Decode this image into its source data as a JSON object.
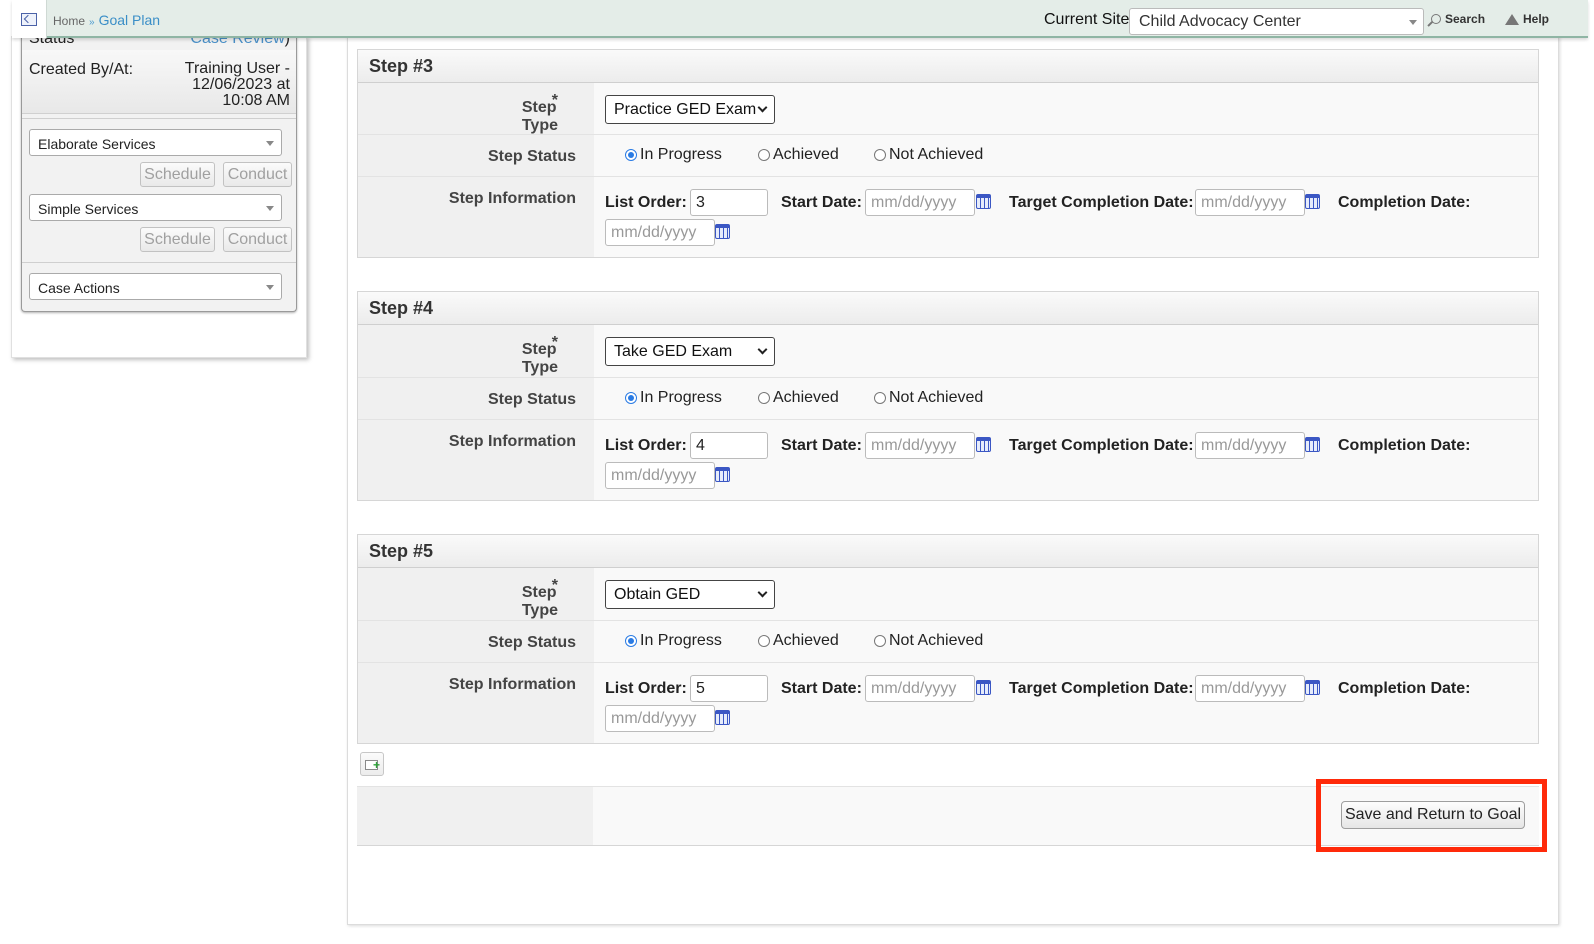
{
  "topbar": {
    "breadcrumb_home": "Home",
    "breadcrumb_sep": "»",
    "breadcrumb_current": "Goal Plan",
    "current_site_label": "Current Site",
    "current_site_value": "Child Advocacy Center",
    "search_label": "Search",
    "help_label": "Help"
  },
  "left_panel": {
    "status_label": "Status",
    "status_value": "Case Review",
    "created_label": "Created By/At:",
    "created_line1": "Training User -",
    "created_line2": "12/06/2023 at",
    "created_line3": "10:08 AM",
    "elaborate_services": "Elaborate Services",
    "simple_services": "Simple Services",
    "case_actions": "Case Actions",
    "schedule_label": "Schedule",
    "conduct_label": "Conduct"
  },
  "labels": {
    "step_type": "Step Type",
    "required_mark": "*",
    "step_status": "Step Status",
    "step_information": "Step Information",
    "in_progress": "In Progress",
    "achieved": "Achieved",
    "not_achieved": "Not Achieved",
    "list_order": "List Order:",
    "start_date": "Start Date:",
    "target_completion_date": "Target Completion Date:",
    "completion_date": "Completion Date:",
    "date_placeholder": "mm/dd/yyyy"
  },
  "steps": [
    {
      "title": "Step #3",
      "type": "Practice GED Exam",
      "status": "In Progress",
      "list_order": "3"
    },
    {
      "title": "Step #4",
      "type": "Take GED Exam",
      "status": "In Progress",
      "list_order": "4"
    },
    {
      "title": "Step #5",
      "type": "Obtain GED",
      "status": "In Progress",
      "list_order": "5"
    }
  ],
  "actions": {
    "save_return": "Save and Return to Goal"
  },
  "colors": {
    "highlight": "#ff2a0a",
    "radio_selected": "#2a7be4",
    "required": "#dd2222",
    "link": "#4a90c8"
  }
}
